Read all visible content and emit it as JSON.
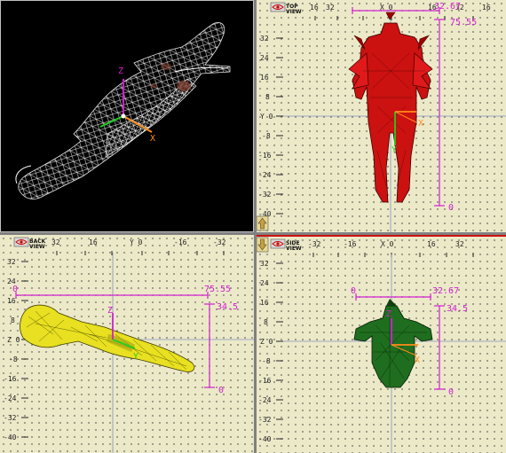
{
  "colors": {
    "accent": "#d21ed2",
    "axis_z": "#d21ed2",
    "axis_x": "#ff8c1a",
    "axis_y": "#22cc22",
    "red_model": "#cc1111",
    "yellow_model": "#e8e020",
    "green_model": "#1f6e1f",
    "highlight": "#e01a1a"
  },
  "viewports": {
    "perspective": {
      "axis_z": "Z",
      "axis_x": "X"
    },
    "top": {
      "label": "TOP VIEW",
      "icon": "eye-icon",
      "corner_icon": "arrow-up-icon",
      "top_ticks": [
        "16",
        "32",
        "X 0",
        "16",
        "32",
        "16"
      ],
      "left_ticks": [
        "32",
        "24",
        "16",
        "8",
        "Y 0",
        "-8",
        "-16",
        "-24",
        "-32",
        "-40"
      ],
      "dim_top": "32.67",
      "dim_right": "75.55",
      "dim_bottom": "0",
      "axis_x": "X",
      "axis_y": "Y"
    },
    "back": {
      "label": "BACK VIEW",
      "icon": "eye-icon",
      "top_ticks": [
        "32",
        "16",
        "Y 0",
        "-16",
        "-32"
      ],
      "left_ticks": [
        "32",
        "24",
        "16",
        "8",
        "Z 0",
        "-8",
        "-16",
        "-24",
        "-32",
        "-40"
      ],
      "dim_left": "0",
      "dim_right": "75.55",
      "dim_height": "34.5",
      "dim_bottom": "0",
      "axis_z": "Z",
      "axis_y": "Y"
    },
    "side": {
      "label": "SIDE VIEW",
      "icon": "eye-icon",
      "corner_icon": "arrow-down-icon",
      "top_ticks": [
        "-32",
        "-16",
        "X 0",
        "16",
        "32"
      ],
      "left_ticks": [
        "32",
        "24",
        "16",
        "8",
        "Z 0",
        "-8",
        "-16",
        "-24",
        "-32",
        "-40"
      ],
      "dim_left": "0",
      "dim_right": "32.67",
      "dim_height": "34.5",
      "dim_bottom": "0",
      "axis_z": "Z",
      "axis_x": "X"
    }
  }
}
